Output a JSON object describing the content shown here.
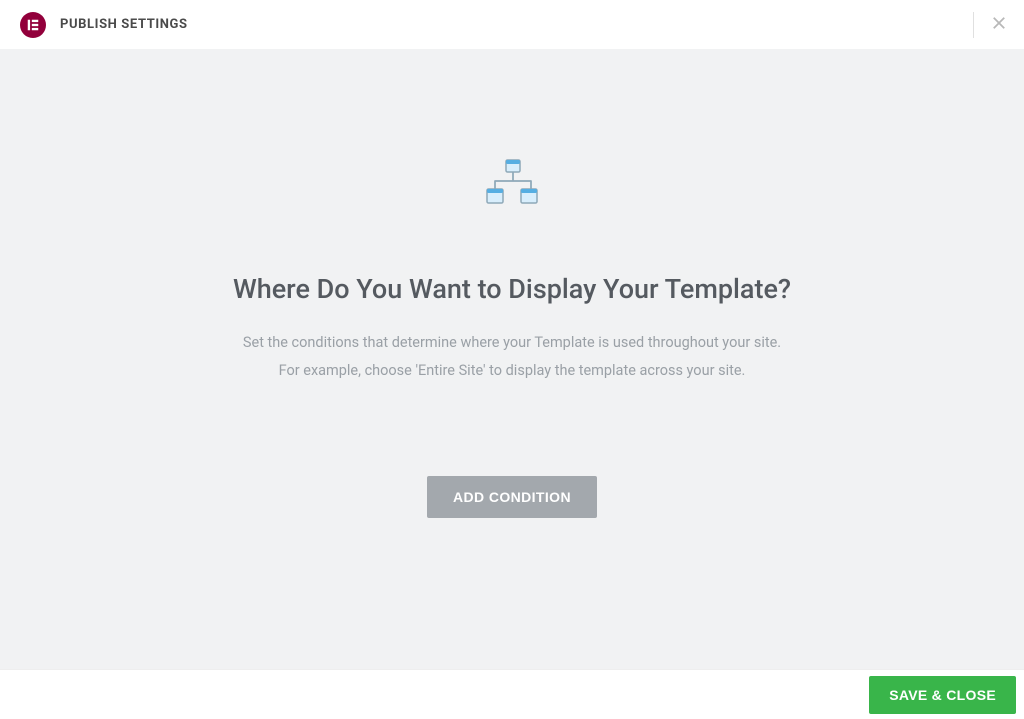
{
  "header": {
    "title": "PUBLISH SETTINGS"
  },
  "main": {
    "heading": "Where Do You Want to Display Your Template?",
    "desc_line1": "Set the conditions that determine where your Template is used throughout your site.",
    "desc_line2": "For example, choose 'Entire Site' to display the template across your site.",
    "add_label": "ADD CONDITION"
  },
  "footer": {
    "save_label": "SAVE & CLOSE"
  }
}
